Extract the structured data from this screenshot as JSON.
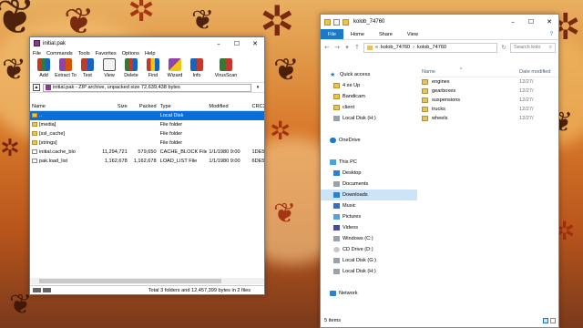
{
  "colors": {
    "accent": "#1979ca",
    "selection": "#0a6ed8",
    "folder": "#e8c35a",
    "archive": "#8a3b8c"
  },
  "winrar": {
    "title": "initial.pak",
    "menu": [
      "File",
      "Commands",
      "Tools",
      "Favorites",
      "Options",
      "Help"
    ],
    "toolbar": [
      {
        "label": "Add",
        "icon": "add-books-icon"
      },
      {
        "label": "Extract To",
        "icon": "extract-icon"
      },
      {
        "label": "Test",
        "icon": "test-icon"
      },
      {
        "label": "View",
        "icon": "view-icon"
      },
      {
        "label": "Delete",
        "icon": "delete-icon"
      },
      {
        "label": "Find",
        "icon": "find-icon"
      },
      {
        "label": "Wizard",
        "icon": "wizard-icon"
      },
      {
        "label": "Info",
        "icon": "info-icon"
      },
      {
        "label": "VirusScan",
        "icon": "virus-scan-icon"
      }
    ],
    "address": "initial.pak - ZIP archive, unpacked size 72,639,438 bytes",
    "columns": [
      "Name",
      "Size",
      "Packed",
      "Type",
      "Modified",
      "CRC3"
    ],
    "rows": [
      {
        "name": "..",
        "size": "",
        "packed": "",
        "type": "Local Disk",
        "modified": "",
        "crc": "",
        "kind": "folder",
        "selected": true
      },
      {
        "name": "[media]",
        "size": "",
        "packed": "",
        "type": "File folder",
        "modified": "",
        "crc": "",
        "kind": "folder"
      },
      {
        "name": "[ssl_cache]",
        "size": "",
        "packed": "",
        "type": "File folder",
        "modified": "",
        "crc": "",
        "kind": "folder"
      },
      {
        "name": "[strings]",
        "size": "",
        "packed": "",
        "type": "File folder",
        "modified": "",
        "crc": "",
        "kind": "folder"
      },
      {
        "name": "initial.cache_blo",
        "size": "11,294,721",
        "packed": "579,650",
        "type": "CACHE_BLOCK File",
        "modified": "1/1/1980 9:00",
        "crc": "1DE5A",
        "kind": "file"
      },
      {
        "name": "pak.load_list",
        "size": "1,162,678",
        "packed": "1,162,678",
        "type": "LOAD_LIST File",
        "modified": "1/1/1980 9:00",
        "crc": "6DE5I",
        "kind": "file"
      }
    ],
    "status": "Total 3 folders and 12,457,399 bytes in 2 files"
  },
  "explorer": {
    "title": "kolob_74760",
    "tabs": [
      "File",
      "Home",
      "Share",
      "View"
    ],
    "path": [
      "kolob_74760",
      "kolob_74760"
    ],
    "search_placeholder": "Search kolo",
    "nav": [
      {
        "label": "Quick access",
        "icon": "star-icon",
        "cls": "star"
      },
      {
        "label": "4 xe Up",
        "icon": "folder-icon",
        "cls": "fold"
      },
      {
        "label": "Bandicam",
        "icon": "folder-icon",
        "cls": "fold"
      },
      {
        "label": "client",
        "icon": "folder-icon",
        "cls": "fold"
      },
      {
        "label": "Local Disk (H:)",
        "icon": "drive-icon",
        "cls": "drive"
      },
      {
        "label": "",
        "icon": "",
        "cls": ""
      },
      {
        "label": "OneDrive",
        "icon": "cloud-icon",
        "cls": "cloud"
      },
      {
        "label": "",
        "icon": "",
        "cls": ""
      },
      {
        "label": "This PC",
        "icon": "computer-icon",
        "cls": "pc"
      },
      {
        "label": "Desktop",
        "icon": "desktop-icon",
        "cls": "blue"
      },
      {
        "label": "Documents",
        "icon": "documents-icon",
        "cls": "drive"
      },
      {
        "label": "Downloads",
        "icon": "downloads-icon",
        "cls": "blue",
        "selected": true
      },
      {
        "label": "Music",
        "icon": "music-icon",
        "cls": "music"
      },
      {
        "label": "Pictures",
        "icon": "pictures-icon",
        "cls": "pic"
      },
      {
        "label": "Videos",
        "icon": "videos-icon",
        "cls": "vid"
      },
      {
        "label": "Windows (C:)",
        "icon": "drive-icon",
        "cls": "drive"
      },
      {
        "label": "CD Drive (D:)",
        "icon": "cd-icon",
        "cls": "cd"
      },
      {
        "label": "Local Disk (G:)",
        "icon": "drive-icon",
        "cls": "drive"
      },
      {
        "label": "Local Disk (H:)",
        "icon": "drive-icon",
        "cls": "drive"
      },
      {
        "label": "",
        "icon": "",
        "cls": ""
      },
      {
        "label": "Network",
        "icon": "network-icon",
        "cls": "net"
      }
    ],
    "files": [
      {
        "name": "engines",
        "date": "12/27/"
      },
      {
        "name": "gearboxes",
        "date": "12/27/"
      },
      {
        "name": "suspensions",
        "date": "12/27/"
      },
      {
        "name": "trucks",
        "date": "12/27/"
      },
      {
        "name": "wheels",
        "date": "12/27/"
      }
    ],
    "status": "5 items"
  }
}
